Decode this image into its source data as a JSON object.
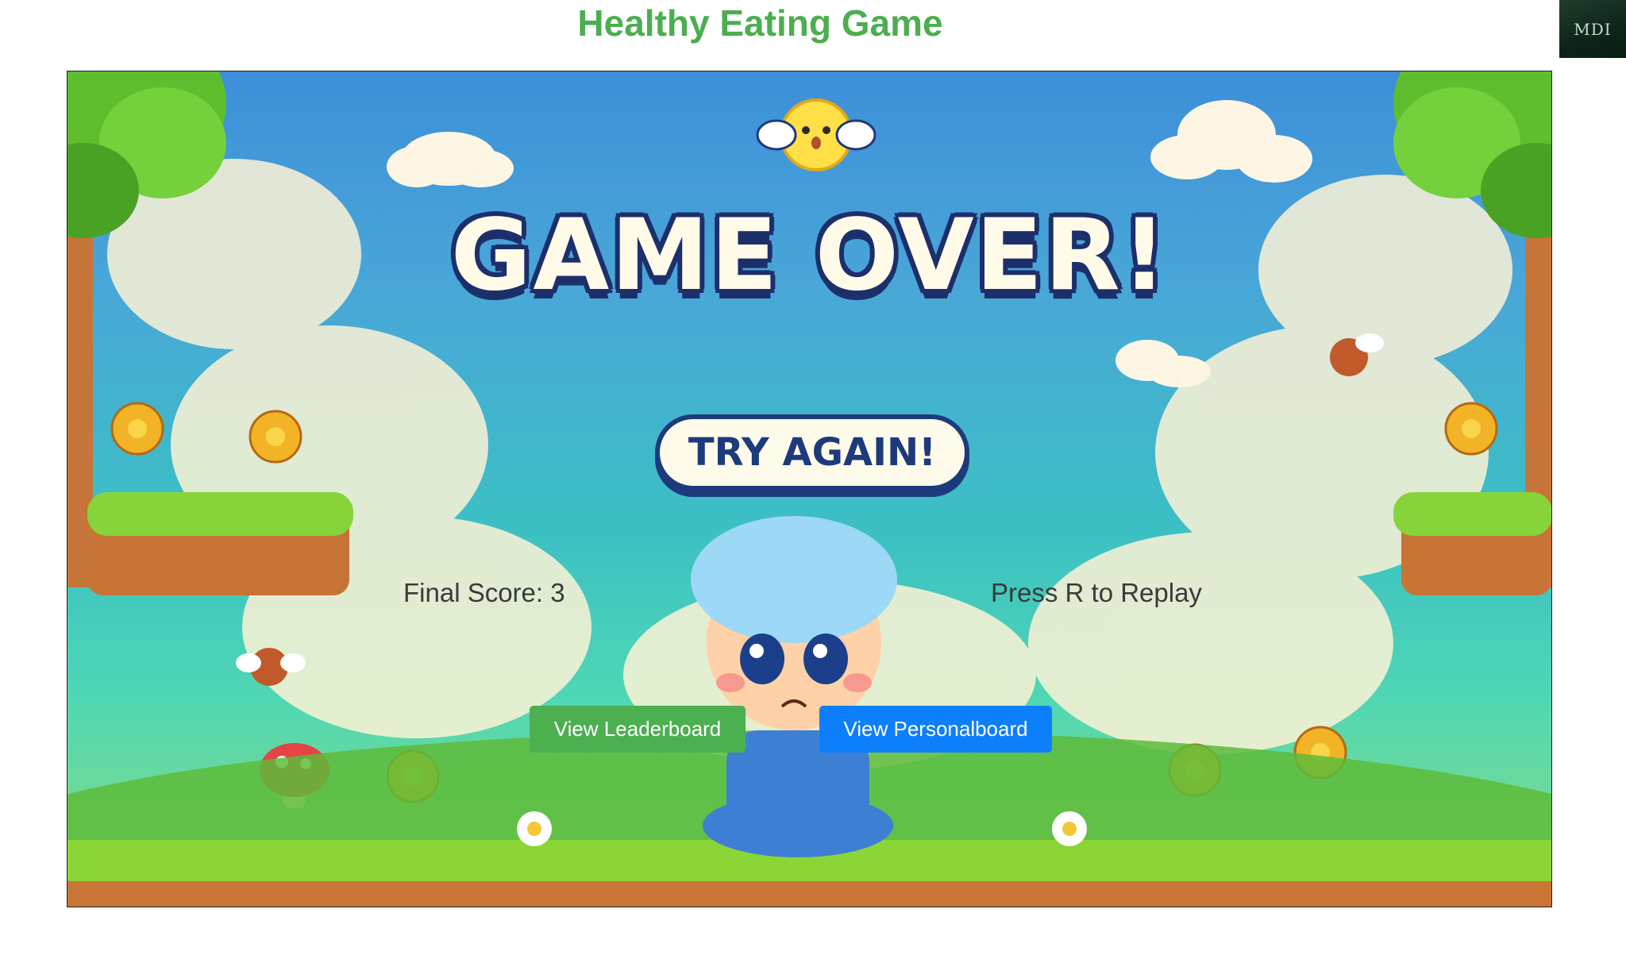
{
  "header": {
    "title": "Healthy Eating Game",
    "logo_text": "MDI"
  },
  "game": {
    "banner_text": "GAME OVER!",
    "try_again_label": "TRY AGAIN!",
    "final_score": "Final Score: 3",
    "replay_hint": "Press R to Replay"
  },
  "buttons": {
    "leaderboard_label": "View Leaderboard",
    "personalboard_label": "View Personalboard"
  },
  "colors": {
    "title_green": "#4cae4f",
    "leaderboard_green": "#4caf50",
    "personalboard_blue": "#0d7ffb"
  }
}
